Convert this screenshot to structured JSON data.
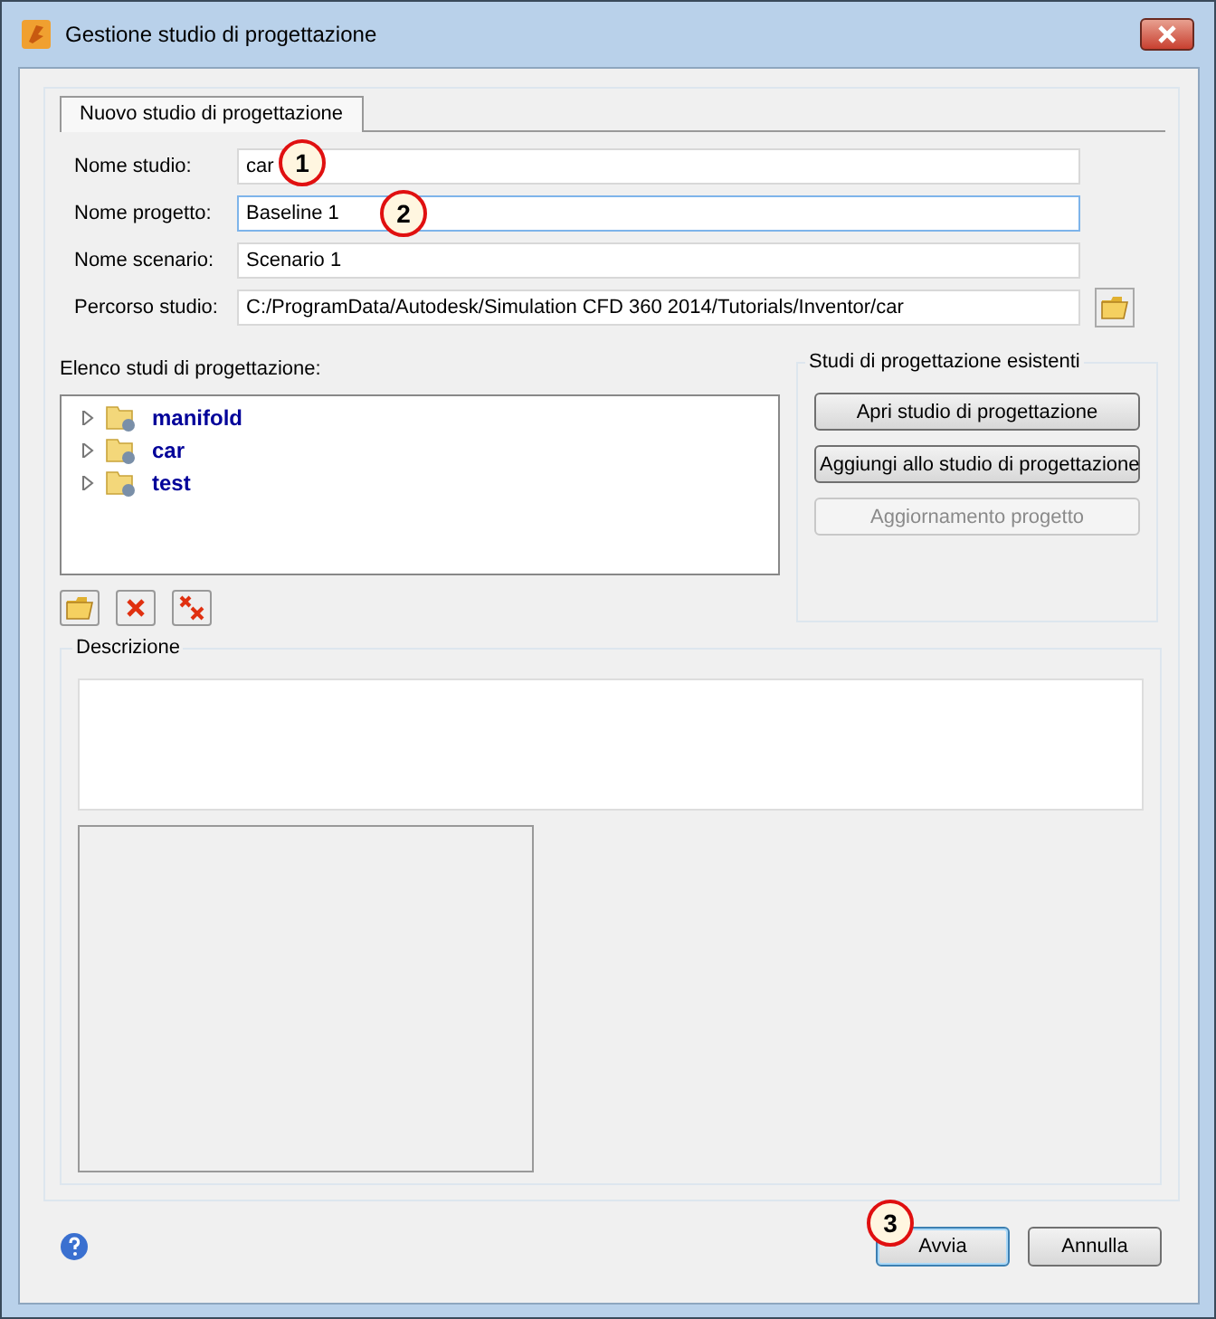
{
  "window": {
    "title": "Gestione studio di progettazione"
  },
  "tabs": [
    {
      "label": "Nuovo studio di progettazione",
      "selected": true
    }
  ],
  "fields": [
    {
      "label": "Nome studio:",
      "value": "car",
      "focused": false
    },
    {
      "label": "Nome progetto:",
      "value": "Baseline 1",
      "focused": true
    },
    {
      "label": "Nome scenario:",
      "value": "Scenario 1",
      "focused": false
    },
    {
      "label": "Percorso studio:",
      "value": "C:/ProgramData/Autodesk/Simulation CFD 360 2014/Tutorials/Inventor/car",
      "focused": false
    }
  ],
  "studies_list": {
    "label": "Elenco studi di progettazione:",
    "items": [
      {
        "label": "manifold",
        "expanded": false
      },
      {
        "label": "car",
        "expanded": false
      },
      {
        "label": "test",
        "expanded": false
      }
    ]
  },
  "existing_studies": {
    "title": "Studi di progettazione esistenti",
    "buttons": [
      {
        "label": "Apri studio di progettazione",
        "disabled": false
      },
      {
        "label": "Aggiungi allo studio di progettazione",
        "disabled": false
      },
      {
        "label": "Aggiornamento progetto",
        "disabled": true
      }
    ]
  },
  "description": {
    "title": "Descrizione"
  },
  "callouts": [
    {
      "number": "1"
    },
    {
      "number": "2"
    },
    {
      "number": "3"
    }
  ],
  "buttons": [
    {
      "label": "Avvia",
      "default": true
    },
    {
      "label": "Annulla",
      "default": false
    }
  ]
}
